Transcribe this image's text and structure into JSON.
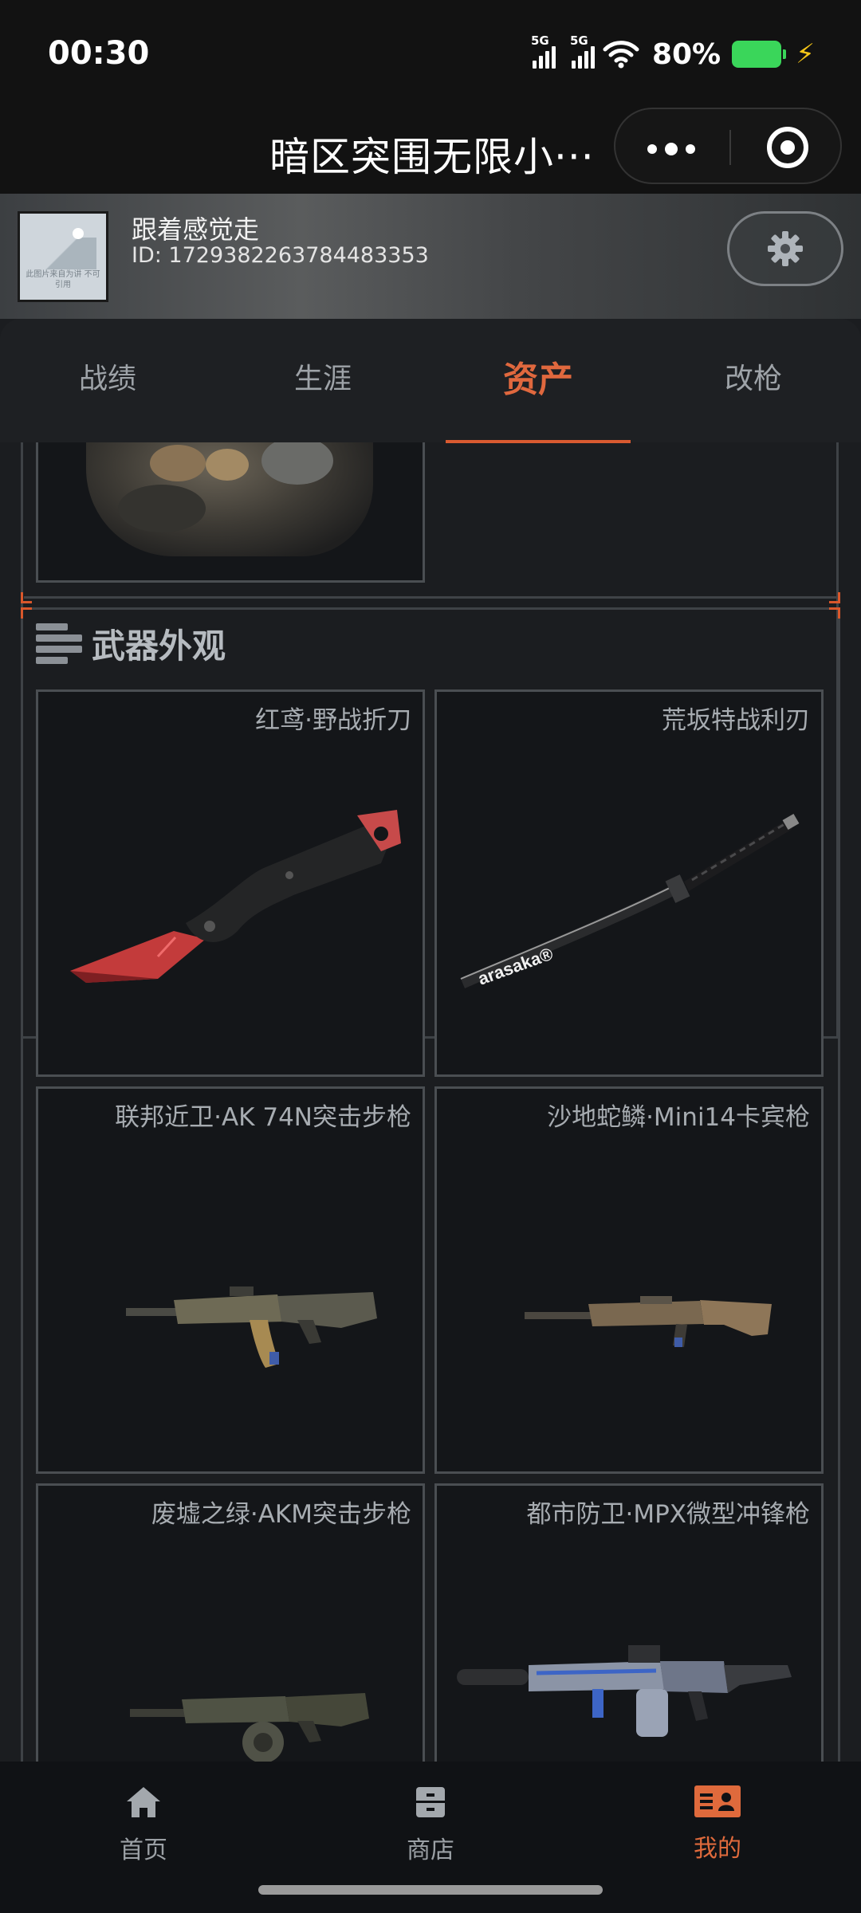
{
  "status_bar": {
    "time": "00:30",
    "sim1_label": "5G",
    "sim2_label": "5G",
    "battery_percent": "80%",
    "battery_level": 0.8,
    "battery_color": "#3ad65a"
  },
  "title_bar": {
    "title": "暗区突围无限小···",
    "more_icon": "more-dots-icon",
    "close_icon": "target-close-icon"
  },
  "profile": {
    "name": "跟着感觉走",
    "id": "ID: 1729382263784483353",
    "avatar_caption": "此图片来自为讲 不可引用",
    "settings_icon": "gear-icon"
  },
  "tabs": [
    {
      "label": "战绩",
      "active": false
    },
    {
      "label": "生涯",
      "active": false
    },
    {
      "label": "资产",
      "active": true
    },
    {
      "label": "改枪",
      "active": false
    }
  ],
  "accent_color": "#d95a30",
  "weapons_section": {
    "title": "武器外观",
    "icon": "ammo-stack-icon",
    "items": [
      {
        "name": "红鸢·野战折刀",
        "icon": "folding-knife-icon"
      },
      {
        "name": "荒坂特战利刃",
        "icon": "katana-icon",
        "engraving": "arasaka®"
      },
      {
        "name": "联邦近卫·AK 74N突击步枪",
        "icon": "assault-rifle-icon"
      },
      {
        "name": "沙地蛇鳞·Mini14卡宾枪",
        "icon": "carbine-icon"
      },
      {
        "name": "废墟之绿·AKM突击步枪",
        "icon": "drum-rifle-icon"
      },
      {
        "name": "都市防卫·MPX微型冲锋枪",
        "icon": "smg-icon"
      }
    ]
  },
  "bottom_nav": [
    {
      "label": "首页",
      "icon": "home-icon",
      "active": false
    },
    {
      "label": "商店",
      "icon": "store-icon",
      "active": false
    },
    {
      "label": "我的",
      "icon": "profile-card-icon",
      "active": true
    }
  ]
}
